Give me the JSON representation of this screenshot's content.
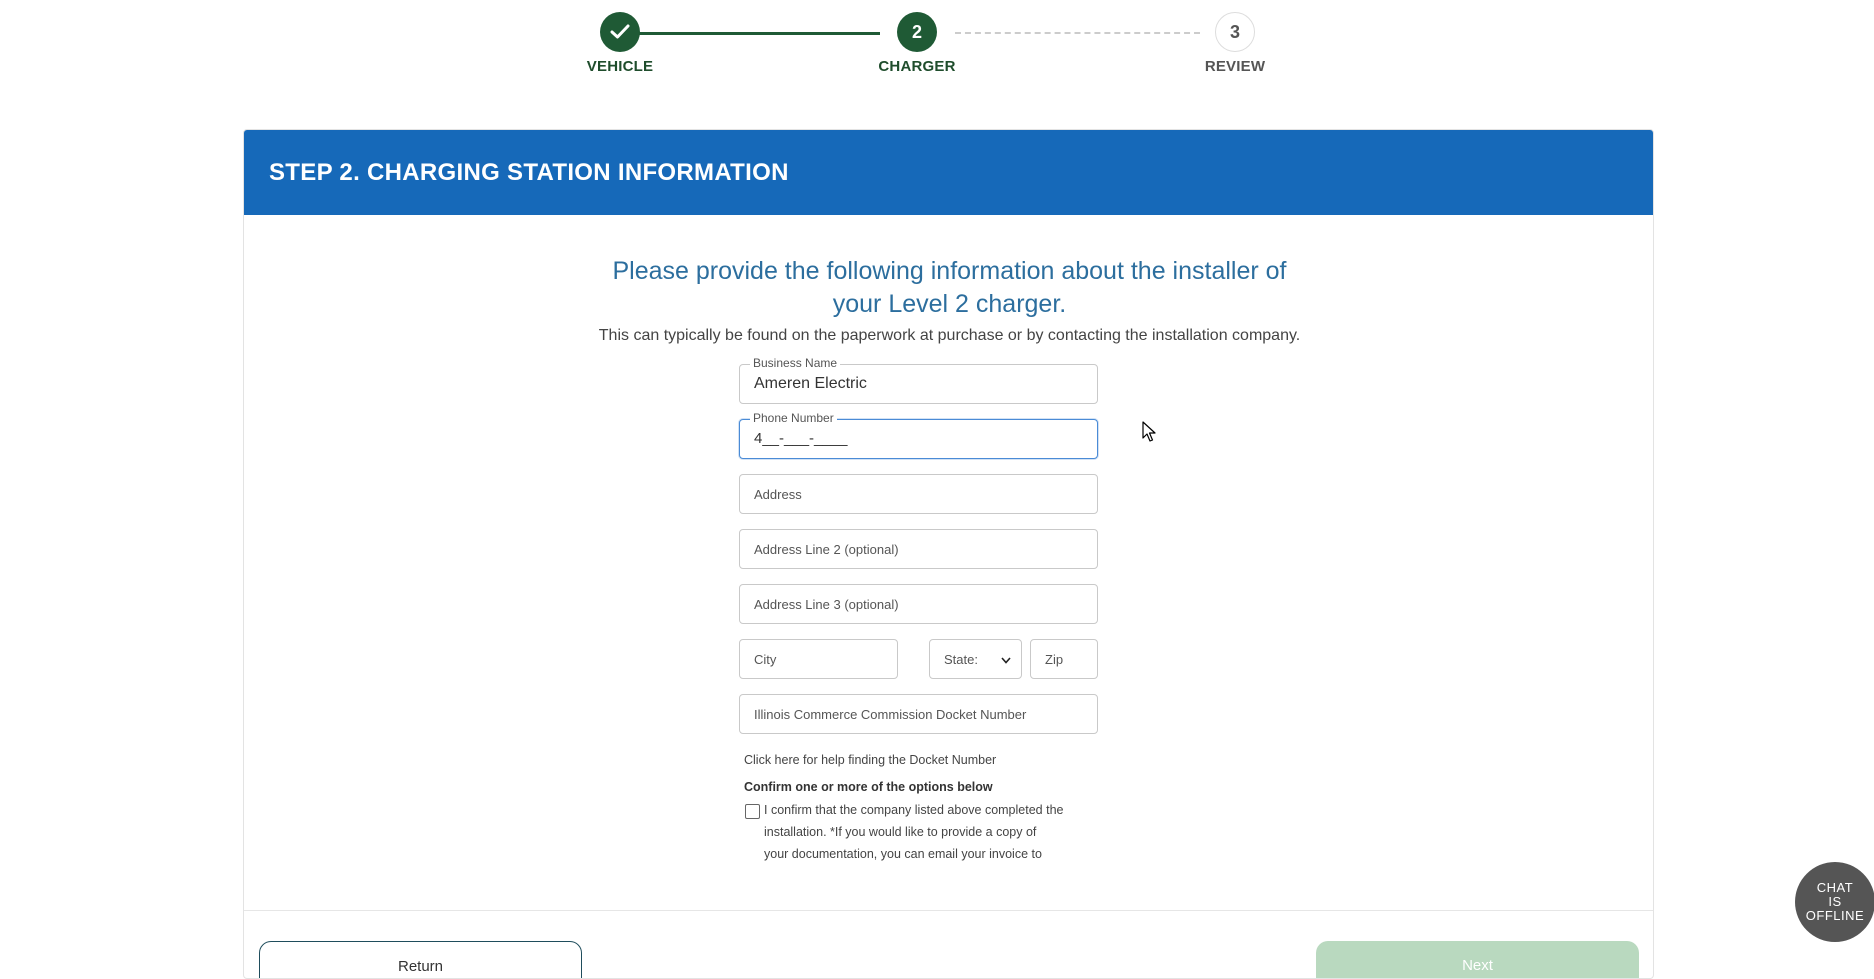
{
  "stepper": {
    "steps": [
      {
        "number": "",
        "label": "VEHICLE",
        "state": "done"
      },
      {
        "number": "2",
        "label": "CHARGER",
        "state": "active"
      },
      {
        "number": "3",
        "label": "REVIEW",
        "state": "todo"
      }
    ]
  },
  "card": {
    "title": "STEP 2. CHARGING STATION INFORMATION",
    "lead": "Please provide the following information about the installer of your Level 2 charger.",
    "sub": "This can typically be found on the paperwork at purchase or by contacting the installation company."
  },
  "form": {
    "business_name": {
      "label": "Business Name",
      "value": "Ameren Electric"
    },
    "phone_number": {
      "label": "Phone Number",
      "value": "4__-___-____"
    },
    "address": {
      "placeholder": "Address"
    },
    "address2": {
      "placeholder": "Address Line 2 (optional)"
    },
    "address3": {
      "placeholder": "Address Line 3 (optional)"
    },
    "city": {
      "placeholder": "City"
    },
    "state": {
      "selected": "State:"
    },
    "zip": {
      "placeholder": "Zip"
    },
    "docket": {
      "placeholder": "Illinois Commerce Commission Docket Number"
    },
    "docket_help": "Click here for help finding the Docket Number",
    "confirm_title": "Confirm one or more of the options below",
    "confirm_option": "I confirm that the company listed above completed the installation. *If you would like to provide a copy of your documentation, you can email your invoice to"
  },
  "buttons": {
    "return": "Return",
    "next": "Next"
  },
  "chat": {
    "line1": "CHAT",
    "line2": "IS",
    "line3": "OFFLINE"
  },
  "colors": {
    "header_blue": "#1669b9",
    "step_green": "#1f5a35",
    "next_disabled": "#b9d9bf"
  }
}
